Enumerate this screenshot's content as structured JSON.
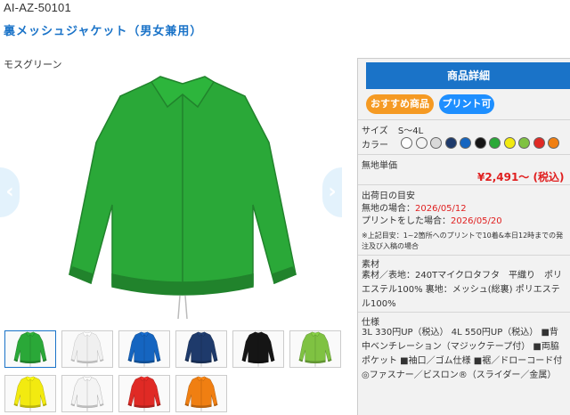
{
  "product": {
    "code": "AI-AZ-50101",
    "title": "裏メッシュジャケット（男女兼用）",
    "color_caption": "モスグリーン"
  },
  "gallery": {
    "prev_arrow": "‹",
    "next_arrow": "›",
    "thumbnails": [
      {
        "color": "#2aa838"
      },
      {
        "color": "#f0f0f0"
      },
      {
        "color": "#1565c0"
      },
      {
        "color": "#1e3a6b"
      },
      {
        "color": "#151515"
      },
      {
        "color": "#7fc242"
      },
      {
        "color": "#f2ea10"
      },
      {
        "color": "#f4f4f4"
      },
      {
        "color": "#e02a25"
      },
      {
        "color": "#f07f12"
      }
    ]
  },
  "panel": {
    "detail_button": "商品詳細",
    "tag_recommend": "おすすめ商品",
    "tag_print": "プリント可",
    "size_label": "サイズ",
    "size_value": "S〜4L",
    "color_label": "カラー",
    "swatches": [
      "#ffffff",
      "#f4f4f4",
      "#d9d9d9",
      "#1e3a6b",
      "#1565c0",
      "#151515",
      "#2aa838",
      "#f2ea10",
      "#7fc242",
      "#e02a25",
      "#f07f12"
    ],
    "unit_price_label": "無地単価",
    "price": "¥2,491〜 (税込)",
    "shipping_label": "出荷日の目安",
    "plain_label": "無地の場合：",
    "plain_date": "2026/05/12",
    "print_label": "プリントをした場合：",
    "print_date": "2026/05/20",
    "shipping_note": "※上記目安：1~2箇所へのプリントで10着&本日12時までの発注及び入稿の場合",
    "material_label": "素材",
    "material_text": "素材／表地：240Tマイクロタフタ　平織り　ポリエステル100% 裏地：メッシュ(総裏) ポリエステル100%",
    "spec_label": "仕様",
    "spec_text": "3L 330円UP（税込） 4L 550円UP（税込） ■背中ベンチレーション（マジックテープ付） ■両脇ポケット ■袖口／ゴム仕様 ■裾／ドローコード付 ◎ファスナー／ビスロン®（スライダー／金属）"
  }
}
